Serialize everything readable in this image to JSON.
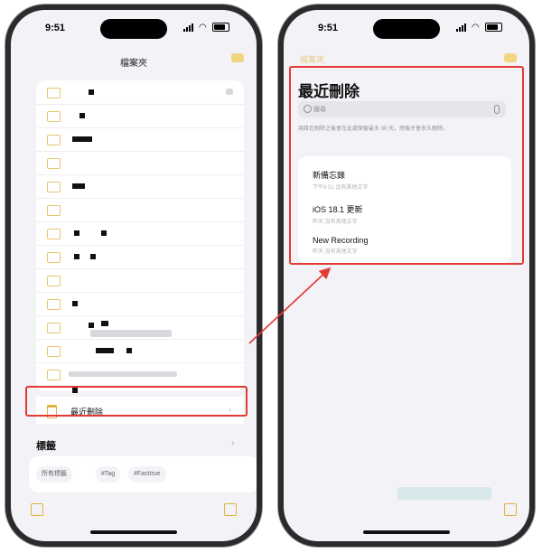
{
  "left_screen": {
    "status": {
      "time": "9:51"
    },
    "nav": {
      "title": "檔案夾"
    },
    "recently_deleted": {
      "label": "最近刪除"
    },
    "tags": {
      "section_title": "標籤",
      "chips": [
        "所有標籤",
        "#Tag",
        "#Fasttrue"
      ]
    }
  },
  "right_screen": {
    "status": {
      "time": "9:51"
    },
    "back_label": "檔案夾",
    "title": "最近刪除",
    "search": {
      "placeholder": "搜尋"
    },
    "notice": "項目在刪除之後會在此處保留最多 30 天，然後才會永久刪除。",
    "notes": [
      {
        "title": "新備忘錄",
        "subtitle": "下午9:51 沒有其他文字"
      },
      {
        "title": "iOS 18.1 更新",
        "subtitle": "昨天 沒有其他文字"
      },
      {
        "title": "New Recording",
        "subtitle": "昨天 沒有其他文字"
      }
    ]
  },
  "colors": {
    "accent": "#e3b23c",
    "highlight": "#e53935",
    "background": "#f2f2f7"
  }
}
